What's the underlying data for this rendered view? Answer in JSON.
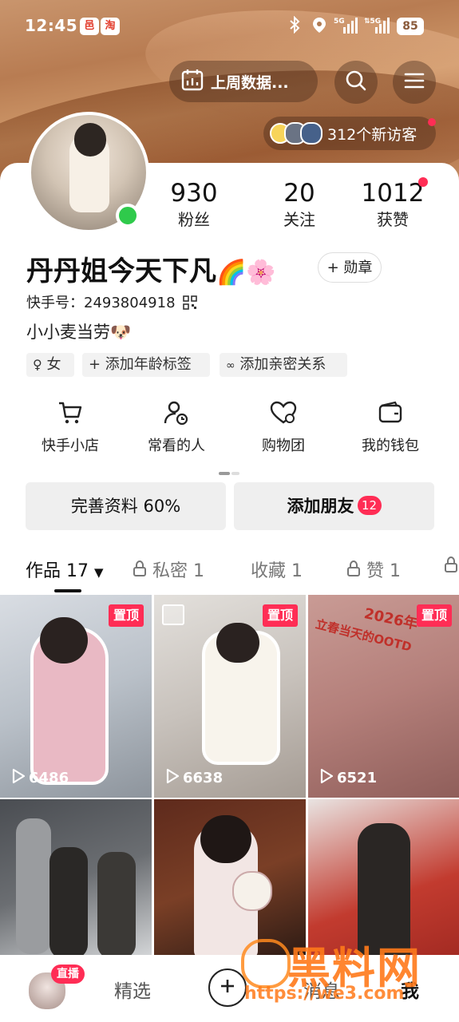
{
  "status_bar": {
    "time": "12:45",
    "badge1": "邑",
    "badge2": "淘",
    "network": "5G 5G",
    "battery": "85"
  },
  "header": {
    "weekly_data_label": "上周数据...",
    "visitors_label": "312个新访客"
  },
  "profile": {
    "name": "丹丹姐今天下凡",
    "name_emoji": "🌈🌸",
    "medal_label": "+ 勋章",
    "kuaishou_id": "快手号：2493804918",
    "bio": "小小麦当劳🐶",
    "tags": [
      "女",
      "+ 添加年龄标签",
      "添加亲密关系"
    ]
  },
  "stats": [
    {
      "value": "930",
      "label": "粉丝"
    },
    {
      "value": "20",
      "label": "关注"
    },
    {
      "value": "1012",
      "label": "获赞"
    }
  ],
  "services": [
    "快手小店",
    "常看的人",
    "购物团",
    "我的钱包"
  ],
  "actions": {
    "complete_profile": "完善资料 60%",
    "add_friends": "添加朋友",
    "add_friends_badge": "12"
  },
  "tabs": [
    "作品 17",
    "私密 1",
    "收藏 1",
    "赞 1"
  ],
  "videos": [
    {
      "pinned": "置顶",
      "plays": "6486"
    },
    {
      "pinned": "置顶",
      "plays": "6638"
    },
    {
      "pinned": "置顶",
      "plays": "6521",
      "overlay_text": "2026年",
      "overlay_text2": "立春当天的OOTD"
    },
    {
      "overlay_text": ""
    },
    {
      "overlay_text": ""
    },
    {
      "overlay_text": ""
    }
  ],
  "bottom_nav": {
    "live_badge": "直播",
    "featured": "精选",
    "messages": "消息",
    "me": "我"
  },
  "watermark": {
    "brand": "黑料网",
    "url": "https://we3.com"
  },
  "colors": {
    "accent": "#ff2d55",
    "online": "#2fca4b"
  }
}
